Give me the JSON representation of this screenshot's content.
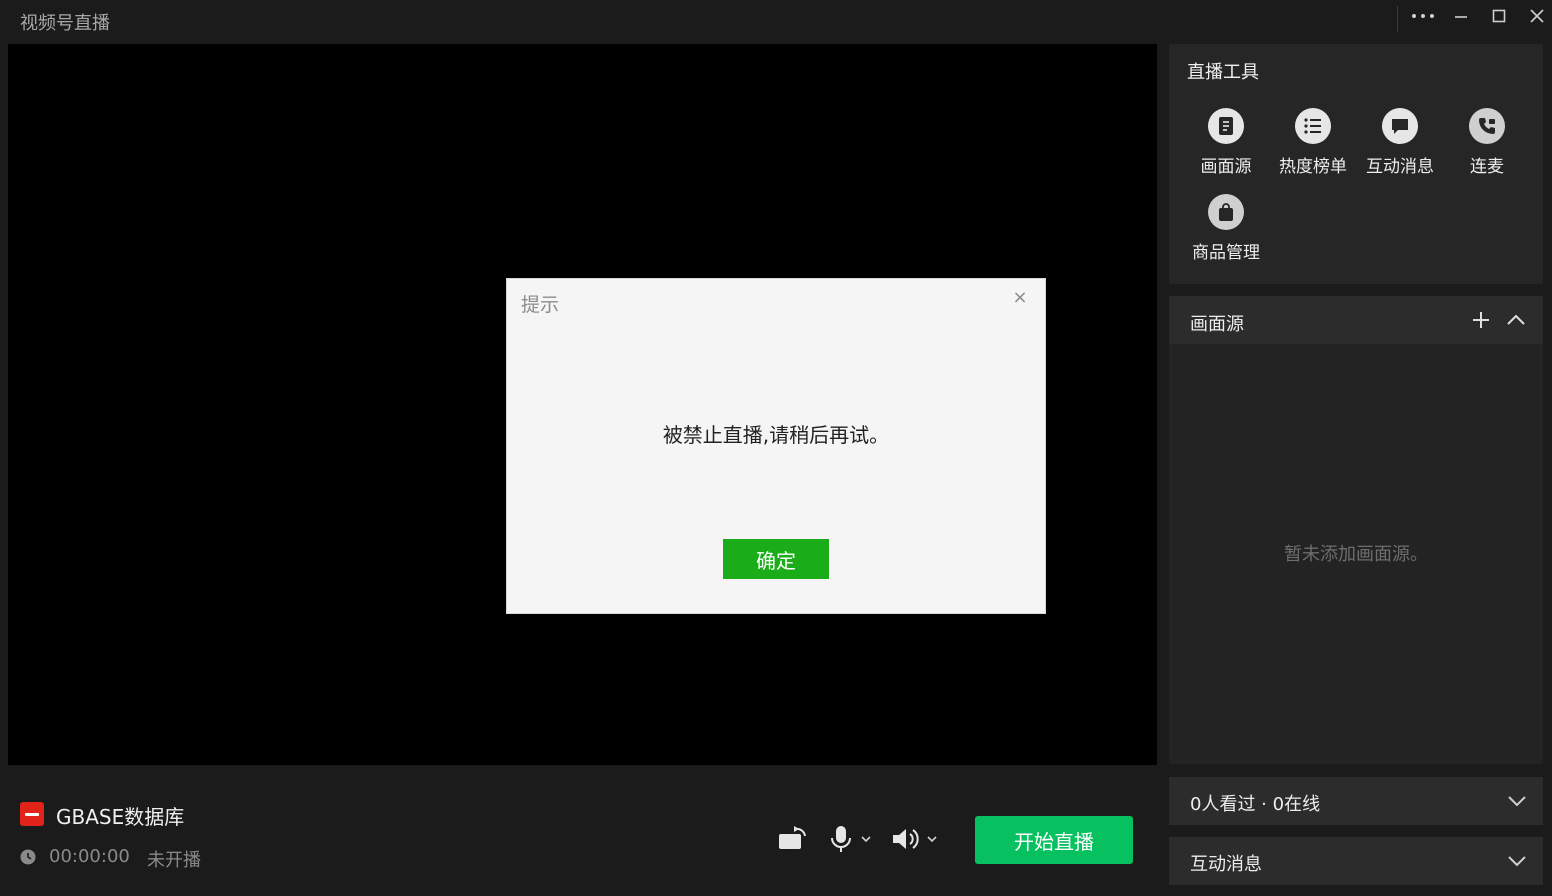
{
  "window": {
    "title": "视频号直播"
  },
  "dialog": {
    "title": "提示",
    "close": "×",
    "message": "被禁止直播,请稍后再试。",
    "ok_label": "确定"
  },
  "account": {
    "name": "GBASE数据库",
    "timer": "00:00:00",
    "status": "未开播"
  },
  "controls": {
    "start_label": "开始直播"
  },
  "tools": {
    "heading": "直播工具",
    "items": [
      {
        "label": "画面源",
        "icon": "source-icon"
      },
      {
        "label": "热度榜单",
        "icon": "list-icon"
      },
      {
        "label": "互动消息",
        "icon": "message-icon"
      },
      {
        "label": "连麦",
        "icon": "phone-icon"
      },
      {
        "label": "商品管理",
        "icon": "bag-icon"
      }
    ]
  },
  "source_panel": {
    "title": "画面源",
    "empty_text": "暂未添加画面源。"
  },
  "viewers_panel": {
    "label": "0人看过 · 0在线"
  },
  "messages_panel": {
    "label": "互动消息"
  },
  "colors": {
    "accent_green": "#07c160",
    "dialog_green": "#1aad19",
    "brand_red": "#e2231a"
  }
}
